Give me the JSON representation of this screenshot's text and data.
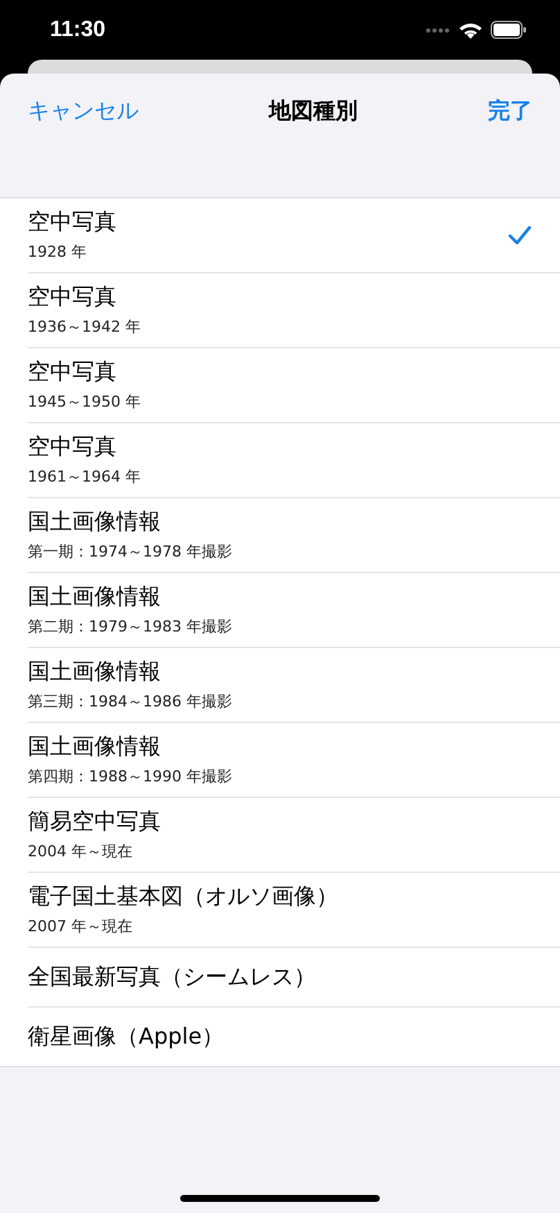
{
  "status_bar": {
    "time": "11:30"
  },
  "nav": {
    "cancel": "キャンセル",
    "title": "地図種別",
    "done": "完了"
  },
  "rows": [
    {
      "title": "空中写真",
      "subtitle": "1928 年",
      "selected": true
    },
    {
      "title": "空中写真",
      "subtitle": "1936～1942 年",
      "selected": false
    },
    {
      "title": "空中写真",
      "subtitle": "1945～1950 年",
      "selected": false
    },
    {
      "title": "空中写真",
      "subtitle": "1961～1964 年",
      "selected": false
    },
    {
      "title": "国土画像情報",
      "subtitle": "第一期：1974～1978 年撮影",
      "selected": false
    },
    {
      "title": "国土画像情報",
      "subtitle": "第二期：1979～1983 年撮影",
      "selected": false
    },
    {
      "title": "国土画像情報",
      "subtitle": "第三期：1984～1986 年撮影",
      "selected": false
    },
    {
      "title": "国土画像情報",
      "subtitle": "第四期：1988～1990 年撮影",
      "selected": false
    },
    {
      "title": "簡易空中写真",
      "subtitle": "2004 年～現在",
      "selected": false
    },
    {
      "title": "電子国土基本図（オルソ画像）",
      "subtitle": "2007 年～現在",
      "selected": false
    },
    {
      "title": "全国最新写真（シームレス）",
      "selected": false
    },
    {
      "title": "衛星画像（Apple）",
      "selected": false
    }
  ]
}
